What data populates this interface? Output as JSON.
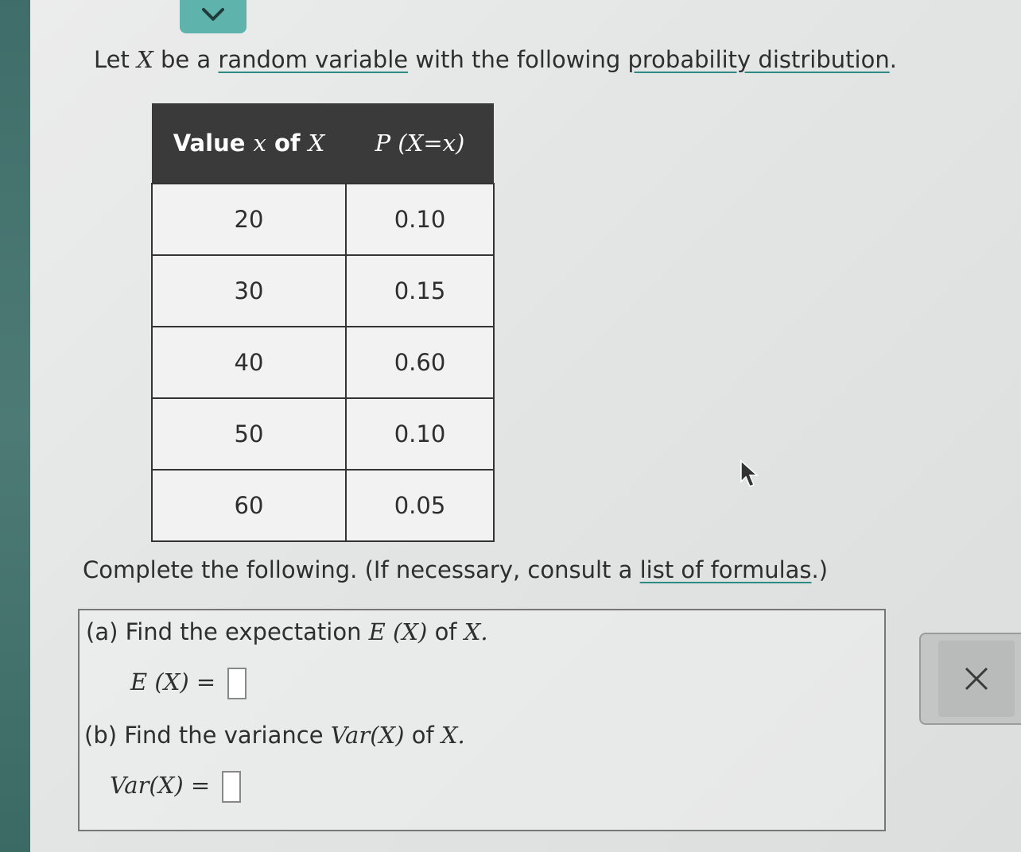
{
  "intro": {
    "let": "Let",
    "var": "X",
    "be_a": "be a",
    "link1": "random variable",
    "with": "with the following",
    "link2": "probability distribution",
    "period": "."
  },
  "table": {
    "header_col1_prefix": "Value",
    "header_col1_x": "x",
    "header_col1_of": "of",
    "header_col1_X": "X",
    "header_col2": "P (X=x)",
    "rows": [
      {
        "x": "20",
        "p": "0.10"
      },
      {
        "x": "30",
        "p": "0.15"
      },
      {
        "x": "40",
        "p": "0.60"
      },
      {
        "x": "50",
        "p": "0.10"
      },
      {
        "x": "60",
        "p": "0.05"
      }
    ]
  },
  "complete": {
    "text": "Complete the following. (If necessary, consult a",
    "link": "list of formulas",
    "end": ".)"
  },
  "part_a": {
    "label": "(a) Find the expectation",
    "expr": "E (X)",
    "of": "of",
    "var": "X.",
    "eq_lhs": "E (X) ="
  },
  "part_b": {
    "label": "(b) Find the variance",
    "expr": "Var(X)",
    "of": "of",
    "var": "X.",
    "eq_lhs": "Var(X) ="
  },
  "icons": {
    "collapse": "chevron-down-icon",
    "close": "close-icon",
    "cursor": "mouse-pointer-icon"
  },
  "colors": {
    "accent_teal": "#5fb3ad",
    "header_dark": "#3a3a3a"
  }
}
